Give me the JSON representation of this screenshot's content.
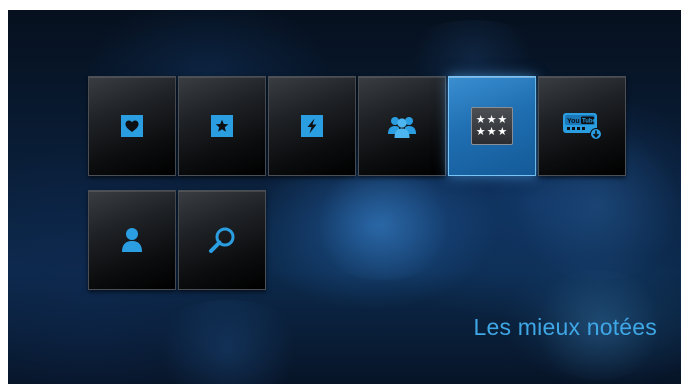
{
  "menu": {
    "tiles": [
      {
        "id": "favorites",
        "icon": "heart-icon"
      },
      {
        "id": "featured",
        "icon": "star-icon"
      },
      {
        "id": "popular",
        "icon": "lightning-icon"
      },
      {
        "id": "community",
        "icon": "people-icon"
      },
      {
        "id": "top-rated",
        "icon": "rating-stars-icon",
        "selected": true,
        "stars_row1": "★★★",
        "stars_row2": "★★★"
      },
      {
        "id": "youtube",
        "icon": "youtube-icon",
        "youtube_text": "You Tube"
      },
      {
        "id": "account",
        "icon": "user-icon"
      },
      {
        "id": "search",
        "icon": "search-icon"
      }
    ]
  },
  "category": {
    "label": "Les mieux notées"
  },
  "colors": {
    "accent": "#2b9ee2",
    "label_text": "#3fa7e6",
    "selected_tile": "#1f6fb2"
  }
}
